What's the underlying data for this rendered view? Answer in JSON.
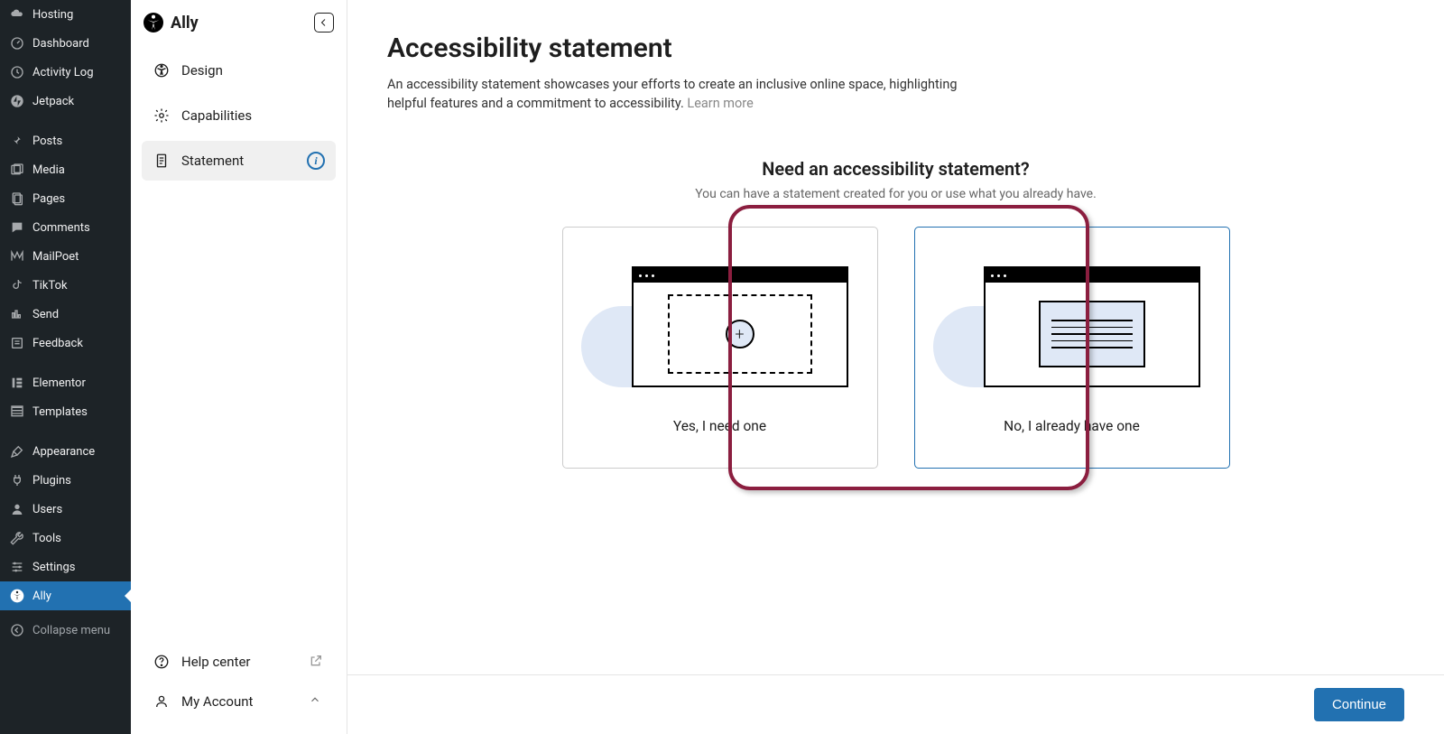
{
  "wp_sidebar": {
    "items": [
      {
        "label": "Hosting",
        "icon": "cloud"
      },
      {
        "label": "Dashboard",
        "icon": "gauge"
      },
      {
        "label": "Activity Log",
        "icon": "clock"
      },
      {
        "label": "Jetpack",
        "icon": "jetpack"
      },
      {
        "sep": true
      },
      {
        "label": "Posts",
        "icon": "pin"
      },
      {
        "label": "Media",
        "icon": "media"
      },
      {
        "label": "Pages",
        "icon": "pages"
      },
      {
        "label": "Comments",
        "icon": "comment"
      },
      {
        "label": "MailPoet",
        "icon": "mailpoet"
      },
      {
        "label": "TikTok",
        "icon": "tiktok"
      },
      {
        "label": "Send",
        "icon": "send"
      },
      {
        "label": "Feedback",
        "icon": "form"
      },
      {
        "sep": true
      },
      {
        "label": "Elementor",
        "icon": "elementor"
      },
      {
        "label": "Templates",
        "icon": "templates"
      },
      {
        "sep": true
      },
      {
        "label": "Appearance",
        "icon": "brush"
      },
      {
        "label": "Plugins",
        "icon": "plug"
      },
      {
        "label": "Users",
        "icon": "user"
      },
      {
        "label": "Tools",
        "icon": "wrench"
      },
      {
        "label": "Settings",
        "icon": "sliders"
      },
      {
        "label": "Ally",
        "icon": "ally",
        "active": true
      },
      {
        "label": "Collapse menu",
        "icon": "collapse",
        "collapse": true
      }
    ]
  },
  "ally_panel": {
    "title": "Ally",
    "nav": [
      {
        "label": "Design",
        "icon": "design"
      },
      {
        "label": "Capabilities",
        "icon": "gear"
      },
      {
        "label": "Statement",
        "icon": "doc",
        "active": true,
        "info": true
      }
    ],
    "footer": [
      {
        "label": "Help center",
        "icon": "help",
        "ext": true
      },
      {
        "label": "My Account",
        "icon": "account",
        "chev": true
      }
    ]
  },
  "main": {
    "title": "Accessibility statement",
    "desc": "An accessibility statement showcases your efforts to create an inclusive online space, highlighting helpful features and a commitment to accessibility. ",
    "learn_more": "Learn more",
    "section_title": "Need an accessibility statement?",
    "section_sub": "You can have a statement created for you or use what you already have.",
    "cards": [
      {
        "label": "Yes, I need one",
        "selected": false,
        "type": "create"
      },
      {
        "label": "No, I already have one",
        "selected": true,
        "type": "existing"
      }
    ],
    "continue": "Continue"
  }
}
